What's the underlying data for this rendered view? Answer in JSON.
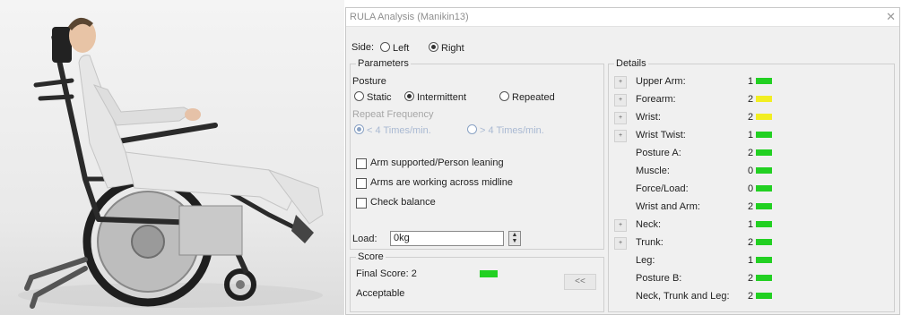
{
  "dialog": {
    "title": "RULA Analysis (Manikin13)",
    "close_icon": "close-icon"
  },
  "side": {
    "label": "Side:",
    "options": [
      {
        "label": "Left",
        "selected": false
      },
      {
        "label": "Right",
        "selected": true
      }
    ]
  },
  "parameters": {
    "group_label": "Parameters",
    "posture_label": "Posture",
    "posture_options": [
      {
        "label": "Static",
        "selected": false
      },
      {
        "label": "Intermittent",
        "selected": true
      },
      {
        "label": "Repeated",
        "selected": false
      }
    ],
    "repeat_frequency_label": "Repeat Frequency",
    "repeat_options": [
      {
        "label": "< 4 Times/min.",
        "selected": true
      },
      {
        "label": "> 4 Times/min.",
        "selected": false
      }
    ],
    "checkboxes": [
      {
        "label": "Arm supported/Person leaning",
        "checked": false
      },
      {
        "label": "Arms are working across midline",
        "checked": false
      },
      {
        "label": "Check balance",
        "checked": false
      }
    ],
    "load_label": "Load:",
    "load_value": "0kg"
  },
  "score": {
    "group_label": "Score",
    "final_score_text": "Final Score: 2",
    "final_score_color": "#22d022",
    "verdict": "Acceptable",
    "collapse_button": "<<"
  },
  "details": {
    "group_label": "Details",
    "rows": [
      {
        "label": "Upper Arm:",
        "value": "1",
        "color": "#22d022",
        "expand_button": "+"
      },
      {
        "label": "Forearm:",
        "value": "2",
        "color": "#f2ee22",
        "expand_button": "+"
      },
      {
        "label": "Wrist:",
        "value": "2",
        "color": "#f2ee22",
        "expand_button": "+"
      },
      {
        "label": "Wrist Twist:",
        "value": "1",
        "color": "#22d022",
        "expand_button": "+"
      },
      {
        "label": "Posture A:",
        "value": "2",
        "color": "#22d022",
        "expand_button": ""
      },
      {
        "label": "Muscle:",
        "value": "0",
        "color": "#22d022",
        "expand_button": ""
      },
      {
        "label": "Force/Load:",
        "value": "0",
        "color": "#22d022",
        "expand_button": ""
      },
      {
        "label": "Wrist and Arm:",
        "value": "2",
        "color": "#22d022",
        "expand_button": ""
      },
      {
        "label": "Neck:",
        "value": "1",
        "color": "#22d022",
        "expand_button": "+"
      },
      {
        "label": "Trunk:",
        "value": "2",
        "color": "#22d022",
        "expand_button": "+"
      },
      {
        "label": "Leg:",
        "value": "1",
        "color": "#22d022",
        "expand_button": ""
      },
      {
        "label": "Posture B:",
        "value": "2",
        "color": "#22d022",
        "expand_button": ""
      },
      {
        "label": "Neck, Trunk and Leg:",
        "value": "2",
        "color": "#22d022",
        "expand_button": ""
      }
    ]
  }
}
